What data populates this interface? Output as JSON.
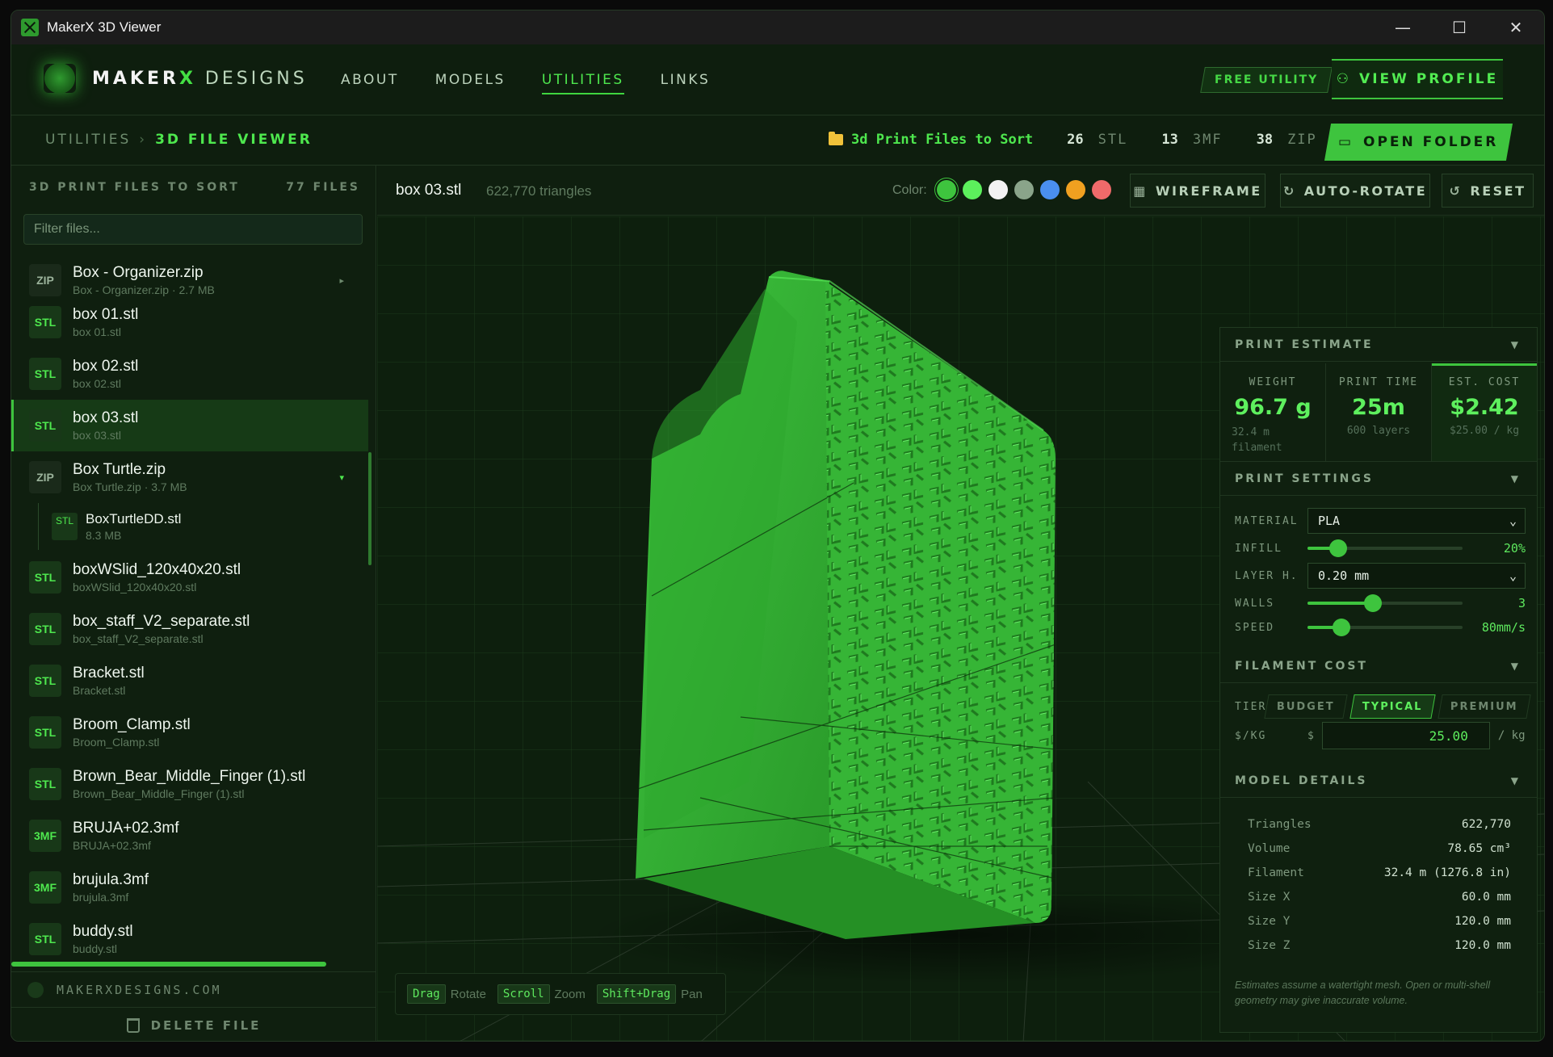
{
  "window": {
    "title": "MakerX 3D Viewer",
    "controls": [
      "—",
      "☐",
      "✕"
    ]
  },
  "brand": {
    "part1": "MAKER",
    "part2": "X",
    "part3": " DESIGNS"
  },
  "nav": {
    "items": [
      "ABOUT",
      "MODELS",
      "UTILITIES",
      "LINKS"
    ],
    "active": "UTILITIES"
  },
  "header": {
    "free_badge": "FREE UTILITY",
    "profile_label": "VIEW PROFILE"
  },
  "breadcrumb": {
    "parent": "UTILITIES",
    "separator": "›",
    "current": "3D FILE VIEWER"
  },
  "folder": {
    "name": "3d Print Files to Sort",
    "stats": [
      {
        "count": "26",
        "label": "STL"
      },
      {
        "count": "13",
        "label": "3MF"
      },
      {
        "count": "38",
        "label": "ZIP"
      }
    ],
    "open_label": "OPEN FOLDER"
  },
  "sidebar": {
    "heading": "3D PRINT FILES TO SORT",
    "count": "77 FILES",
    "filter_placeholder": "Filter files...",
    "files": [
      {
        "type": "ZIP",
        "name": "Box - Organizer.zip",
        "sub": "Box - Organizer.zip · 2.7 MB",
        "caret": "▸"
      },
      {
        "type": "STL",
        "name": "box 01.stl",
        "sub": "box 01.stl"
      },
      {
        "type": "STL",
        "name": "box 02.stl",
        "sub": "box 02.stl"
      },
      {
        "type": "STL",
        "name": "box 03.stl",
        "sub": "box 03.stl",
        "selected": true
      },
      {
        "type": "ZIP",
        "name": "Box Turtle.zip",
        "sub": "Box Turtle.zip · 3.7 MB",
        "caret": "▾"
      },
      {
        "type": "STL",
        "name": "boxWSlid_120x40x20.stl",
        "sub": "boxWSlid_120x40x20.stl"
      },
      {
        "type": "STL",
        "name": "box_staff_V2_separate.stl",
        "sub": "box_staff_V2_separate.stl"
      },
      {
        "type": "STL",
        "name": "Bracket.stl",
        "sub": "Bracket.stl"
      },
      {
        "type": "STL",
        "name": "Broom_Clamp.stl",
        "sub": "Broom_Clamp.stl"
      },
      {
        "type": "STL",
        "name": "Brown_Bear_Middle_Finger (1).stl",
        "sub": "Brown_Bear_Middle_Finger (1).stl"
      },
      {
        "type": "3MF",
        "name": "BRUJA+02.3mf",
        "sub": "BRUJA+02.3mf"
      },
      {
        "type": "3MF",
        "name": "brujula.3mf",
        "sub": "brujula.3mf"
      },
      {
        "type": "STL",
        "name": "buddy.stl",
        "sub": "buddy.stl"
      }
    ],
    "subfile": {
      "type": "STL",
      "name": "BoxTurtleDD.stl",
      "sub": "8.3 MB"
    },
    "site": "MAKERXDESIGNS.COM",
    "delete_label": "DELETE FILE"
  },
  "viewer": {
    "model_name": "box 03.stl",
    "triangles": "622,770 triangles",
    "color_label": "Color:",
    "colors": [
      "#3ec43e",
      "#5cf05c",
      "#f2f2f2",
      "#8aa48a",
      "#4a8ff0",
      "#f0a020",
      "#f06a6a"
    ],
    "buttons": {
      "wireframe": "WIREFRAME",
      "autorotate": "AUTO-ROTATE",
      "reset": "RESET"
    },
    "hints": [
      {
        "key": "Drag",
        "desc": "Rotate"
      },
      {
        "key": "Scroll",
        "desc": "Zoom"
      },
      {
        "key": "Shift+Drag",
        "desc": "Pan"
      }
    ]
  },
  "panel": {
    "estimate_title": "PRINT ESTIMATE",
    "weight": {
      "label": "WEIGHT",
      "value": "96.7 g",
      "sub1": "32.4 m",
      "sub2": "filament"
    },
    "time": {
      "label": "PRINT TIME",
      "value": "25m",
      "sub": "600 layers"
    },
    "cost": {
      "label": "EST. COST",
      "value": "$2.42",
      "sub": "$25.00 / kg"
    },
    "settings_title": "PRINT SETTINGS",
    "material": {
      "label": "MATERIAL",
      "value": "PLA"
    },
    "infill": {
      "label": "INFILL",
      "value": "20%",
      "fraction": 0.2
    },
    "layer": {
      "label": "LAYER H.",
      "value": "0.20 mm"
    },
    "walls": {
      "label": "WALLS",
      "value": "3",
      "fraction": 0.42
    },
    "speed": {
      "label": "SPEED",
      "value": "80mm/s",
      "fraction": 0.22
    },
    "filament_title": "FILAMENT COST",
    "tier": {
      "label": "TIER",
      "options": [
        "BUDGET",
        "TYPICAL",
        "PREMIUM"
      ],
      "active": "TYPICAL"
    },
    "price": {
      "label": "$/KG",
      "currency": "$",
      "value": "25.00",
      "unit": "/ kg"
    },
    "details_title": "MODEL DETAILS",
    "details": [
      {
        "k": "Triangles",
        "v": "622,770"
      },
      {
        "k": "Volume",
        "v": "78.65 cm³"
      },
      {
        "k": "Filament",
        "v": "32.4 m (1276.8 in)"
      },
      {
        "k": "Size X",
        "v": "60.0 mm"
      },
      {
        "k": "Size Y",
        "v": "120.0 mm"
      },
      {
        "k": "Size Z",
        "v": "120.0 mm"
      }
    ],
    "note": "Estimates assume a watertight mesh. Open or multi-shell geometry may give inaccurate volume."
  }
}
